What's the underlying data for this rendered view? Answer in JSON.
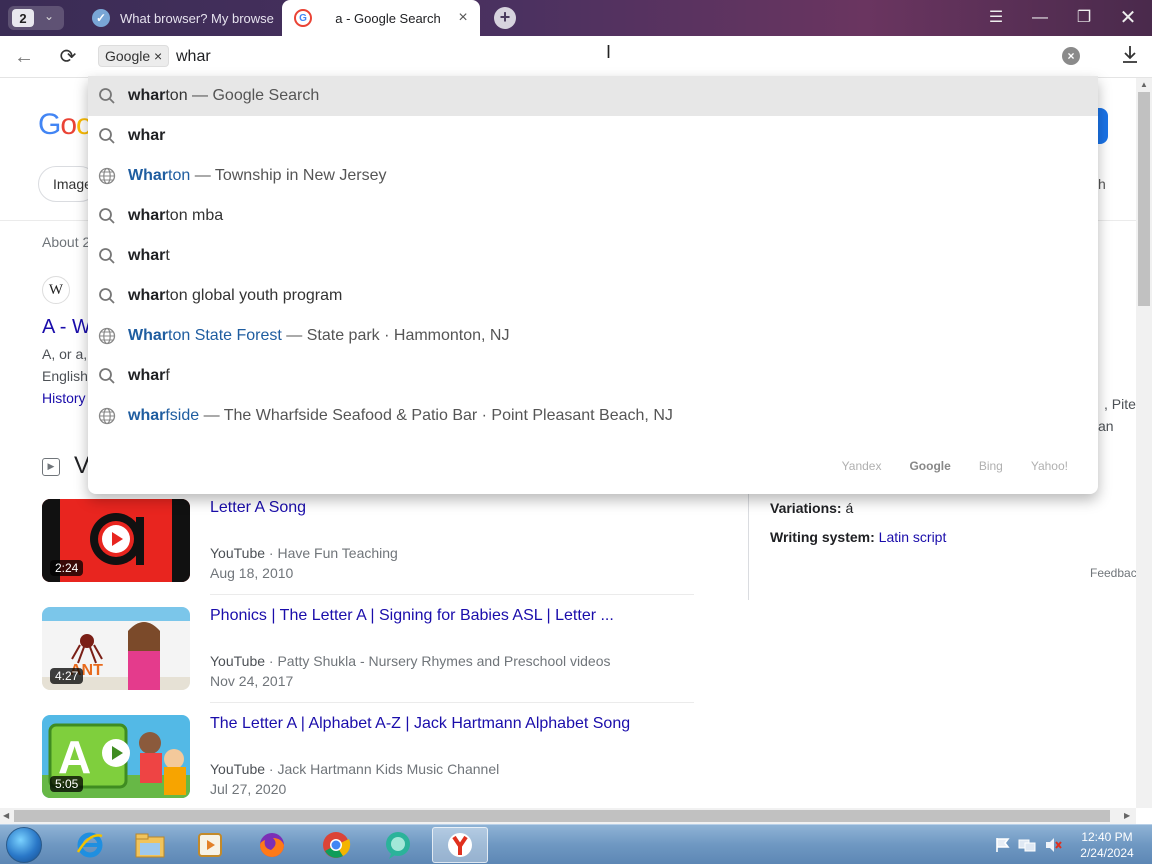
{
  "tabs": {
    "count": "2",
    "items": [
      {
        "title": "What browser? My browse",
        "active": false
      },
      {
        "title": "a - Google Search",
        "active": true
      }
    ]
  },
  "omnibox": {
    "engine_chip": "Google ×",
    "value": "whar"
  },
  "suggestions": [
    {
      "icon": "search-icon",
      "typed": "whar",
      "rest": "ton",
      "detail": " — Google Search",
      "entity": false,
      "selected": true
    },
    {
      "icon": "search-icon",
      "typed": "whar",
      "rest": "",
      "detail": "",
      "entity": false,
      "selected": false
    },
    {
      "icon": "globe-icon",
      "typed": "Whar",
      "rest": "ton",
      "detail": " — Township in New Jersey",
      "entity": true,
      "selected": false
    },
    {
      "icon": "search-icon",
      "typed": "whar",
      "rest": "ton mba",
      "detail": "",
      "entity": false,
      "selected": false
    },
    {
      "icon": "search-icon",
      "typed": "whar",
      "rest": "t",
      "detail": "",
      "entity": false,
      "selected": false
    },
    {
      "icon": "search-icon",
      "typed": "whar",
      "rest": "ton global youth program",
      "detail": "",
      "entity": false,
      "selected": false
    },
    {
      "icon": "globe-icon",
      "typed": "Whar",
      "rest": "ton State Forest",
      "detail": " — State park · Hammonton, NJ",
      "entity": true,
      "selected": false
    },
    {
      "icon": "search-icon",
      "typed": "whar",
      "rest": "f",
      "detail": "",
      "entity": false,
      "selected": false
    },
    {
      "icon": "globe-icon",
      "typed": "whar",
      "rest": "fside",
      "detail": " — The Wharfside Seafood & Patio Bar · Point Pleasant Beach, NJ",
      "entity": true,
      "selected": false
    }
  ],
  "search_engines": [
    "Yandex",
    "Google",
    "Bing",
    "Yahoo!"
  ],
  "active_engine": "Google",
  "page": {
    "logo_letters": [
      "G",
      "o",
      "o"
    ],
    "images_chip": "Image",
    "tools_fragment": "h",
    "about_fragment": "About 2",
    "wiki_icon": "W",
    "result_title_fragment": "A - W",
    "snippet_fragments": [
      "A, or a,",
      "English",
      "History"
    ],
    "kp_fragments": [
      ", Pite",
      "an"
    ],
    "videos_heading_fragment": "V",
    "videos": [
      {
        "title": "Letter A Song",
        "source": "YouTube",
        "channel": "Have Fun Teaching",
        "date": "Aug 18, 2010",
        "duration": "2:24"
      },
      {
        "title": "Phonics | The Letter A | Signing for Babies ASL | Letter ...",
        "source": "YouTube",
        "channel": "Patty Shukla - Nursery Rhymes and Preschool videos",
        "date": "Nov 24, 2017",
        "duration": "4:27"
      },
      {
        "title": "The Letter A | Alphabet A-Z | Jack Hartmann Alphabet Song",
        "source": "YouTube",
        "channel": "Jack Hartmann Kids Music Channel",
        "date": "Jul 27, 2020",
        "duration": "5:05"
      }
    ],
    "knowledge_panel": {
      "variations_label": "Variations:",
      "variations_value": "á",
      "writing_label": "Writing system:",
      "writing_value": "Latin script",
      "feedback": "Feedbac"
    }
  },
  "taskbar": {
    "time": "12:40 PM",
    "date": "2/24/2024"
  }
}
